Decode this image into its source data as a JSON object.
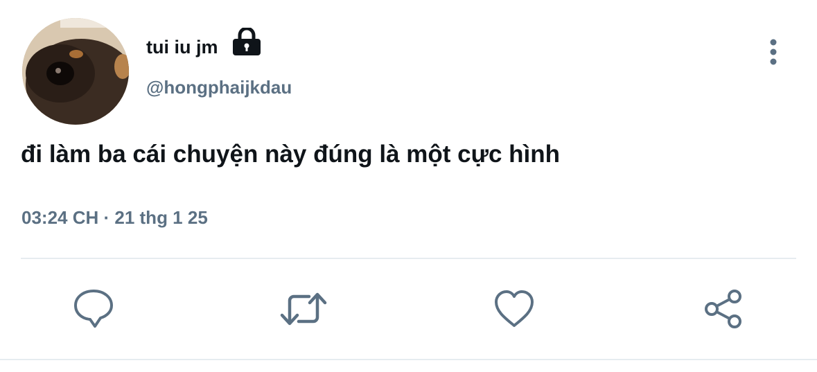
{
  "tweet": {
    "author": {
      "display_name": "tui iu jm",
      "handle": "@hongphaijkdau",
      "protected_icon": "lock-icon",
      "avatar": "avatar-photo"
    },
    "text": "đi làm ba cái chuyện này đúng là một cực hình",
    "timestamp": "03:24 CH · 21 thg 1 25",
    "menu_icon": "more-vertical-icon"
  },
  "actions": [
    {
      "name": "reply",
      "icon": "reply-icon"
    },
    {
      "name": "retweet",
      "icon": "retweet-icon"
    },
    {
      "name": "like",
      "icon": "heart-icon"
    },
    {
      "name": "share",
      "icon": "share-icon"
    }
  ],
  "colors": {
    "primary_text": "#0f1419",
    "secondary_text": "#5b7083",
    "divider": "#e6ecf0"
  }
}
